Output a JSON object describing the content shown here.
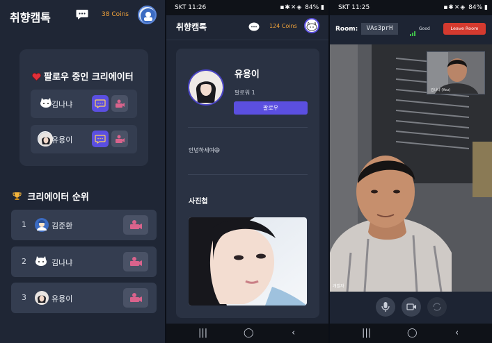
{
  "panel1": {
    "app_title": "취향캠톡",
    "coins": "38 Coins",
    "following_title": "팔로우 중인 크리에이터",
    "following": [
      {
        "name": "김나냐"
      },
      {
        "name": "유용이"
      }
    ],
    "ranking_title": "크리에이터 순위",
    "ranking": [
      {
        "rank": "1",
        "name": "김준환"
      },
      {
        "rank": "2",
        "name": "김나냐"
      },
      {
        "rank": "3",
        "name": "유용이"
      }
    ]
  },
  "panel2": {
    "status_time": "SKT 11:26",
    "status_battery": "84%",
    "app_title": "취향캠톡",
    "coins": "124 Coins",
    "profile_name": "유용이",
    "followers": "팔로워 1",
    "follow_button": "팔로우",
    "greeting": "안녕하세여😄",
    "album_title": "사진첩"
  },
  "panel3": {
    "status_time": "SKT 11:25",
    "status_battery": "84%",
    "room_label": "Room:",
    "room_code": "VAs3prH",
    "connection": "Good",
    "leave_button": "Leave Room",
    "pip_label": "김나냐 (You)",
    "main_label": "개발자"
  },
  "colors": {
    "accent": "#5b4fe0",
    "coins": "#f2a33a",
    "leave": "#d43a2f",
    "background": "#1f2635",
    "card": "#2a3243"
  },
  "icons": [
    "chat-bubble-icon",
    "heart-icon",
    "trophy-icon",
    "video-call-icon",
    "mic-icon",
    "camera-icon",
    "flip-camera-icon",
    "signal-icon"
  ]
}
